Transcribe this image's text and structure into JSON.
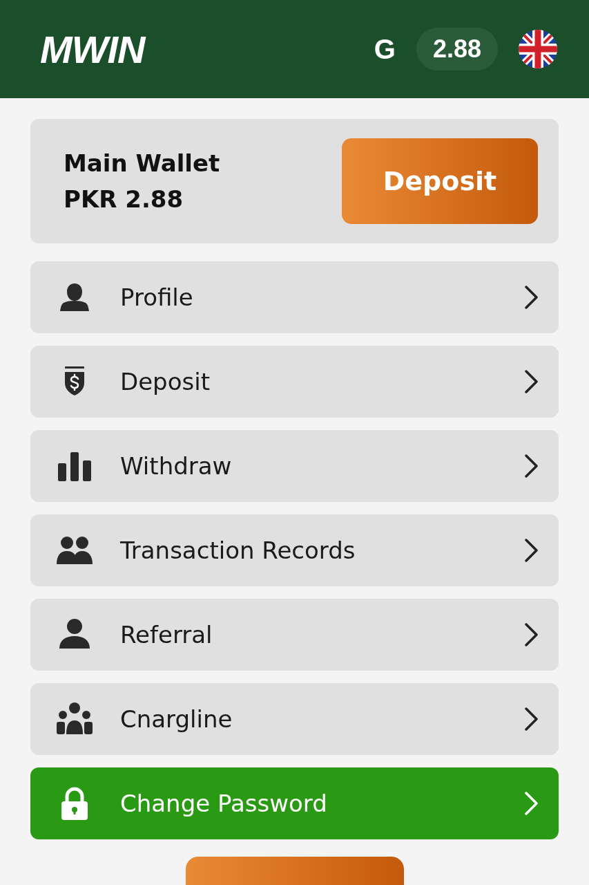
{
  "header": {
    "logo": "MWIN",
    "currency_symbol": "G",
    "balance": "2.88"
  },
  "wallet": {
    "title": "Main Wallet",
    "amount": "PKR 2.88",
    "button": "Deposit"
  },
  "menu": [
    {
      "label": "Profile",
      "highlighted": false
    },
    {
      "label": "Deposit",
      "highlighted": false
    },
    {
      "label": "Withdraw",
      "highlighted": false
    },
    {
      "label": "Transaction Records",
      "highlighted": false
    },
    {
      "label": "Referral",
      "highlighted": false
    },
    {
      "label": "Cnargline",
      "highlighted": false
    },
    {
      "label": "Change Password",
      "highlighted": true
    }
  ]
}
